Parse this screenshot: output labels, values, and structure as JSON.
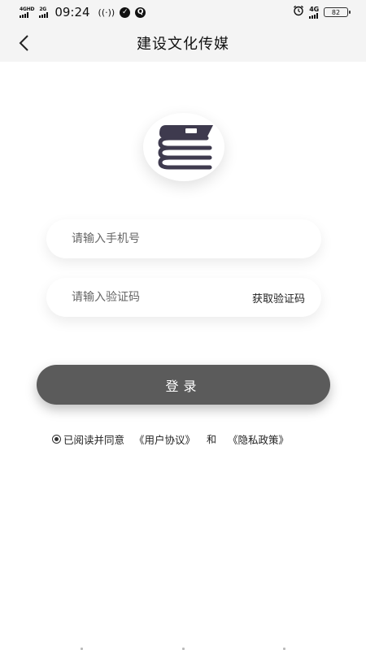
{
  "status_bar": {
    "network1": "4GHD",
    "network2": "2G",
    "time": "09:24",
    "wifi_text": "((·))",
    "right_network": "4G",
    "battery": "82"
  },
  "nav": {
    "back_icon": "chevron-left-icon",
    "title": "建设文化传媒"
  },
  "logo": {
    "icon": "book-stack-icon"
  },
  "form": {
    "phone_placeholder": "请输入手机号",
    "phone_value": "",
    "code_placeholder": "请输入验证码",
    "code_value": "",
    "get_code_label": "获取验证码"
  },
  "login_label": "登录",
  "agreement": {
    "prefix": "已阅读并同意",
    "user_agreement": "《用户协议》",
    "and": "和",
    "privacy_policy": "《隐私政策》"
  }
}
